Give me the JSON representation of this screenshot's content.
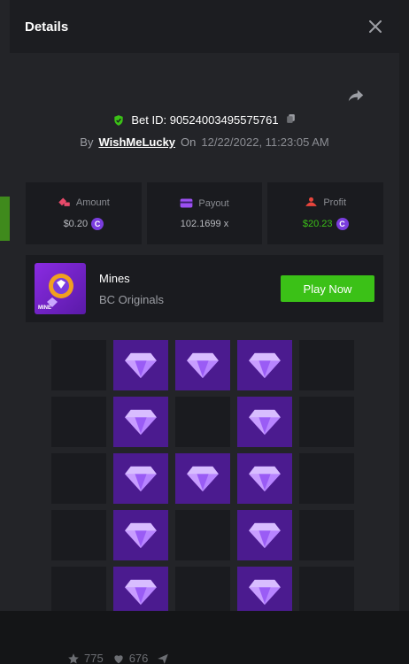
{
  "modal": {
    "title": "Details"
  },
  "bet": {
    "id_text": "Bet ID: 90524003495575761",
    "by_label": "By",
    "username": "WishMeLucky",
    "on_label": "On",
    "datetime": "12/22/2022, 11:23:05 AM"
  },
  "stats": {
    "amount": {
      "label": "Amount",
      "value": "$0.20"
    },
    "payout": {
      "label": "Payout",
      "value": "102.1699 x"
    },
    "profit": {
      "label": "Profit",
      "value": "$20.23"
    }
  },
  "game": {
    "name": "Mines",
    "provider": "BC Originals",
    "play_label": "Play Now",
    "thumb_text": "MINE"
  },
  "grid": {
    "rows": 5,
    "cols": 5,
    "cells": [
      0,
      1,
      1,
      1,
      0,
      0,
      1,
      0,
      1,
      0,
      0,
      1,
      1,
      1,
      0,
      0,
      1,
      0,
      1,
      0,
      0,
      1,
      0,
      1,
      0
    ]
  },
  "footer": {
    "stars": "775",
    "likes": "676"
  },
  "colors": {
    "accent_green": "#3bc117",
    "gem_bg": "#4b1b8f",
    "coin": "#7a3dde"
  },
  "icons": {
    "close": "close-icon",
    "share": "share-icon",
    "shield": "shield-check-icon",
    "copy": "copy-icon",
    "amount": "amount-icon",
    "payout": "wallet-icon",
    "profit": "profit-icon",
    "gem": "gem-icon"
  }
}
